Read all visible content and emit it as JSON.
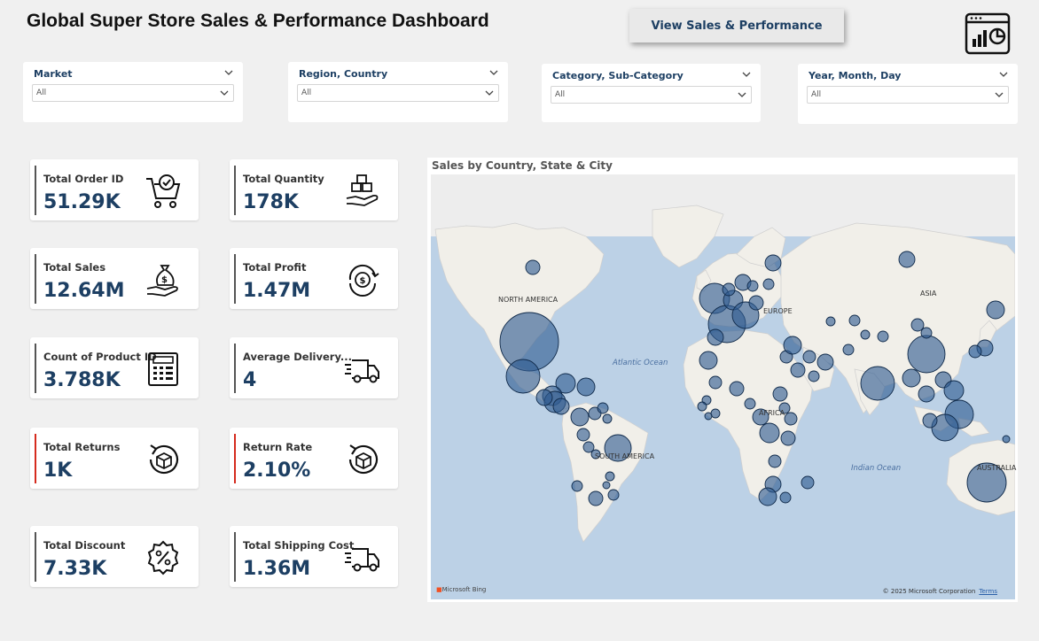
{
  "header": {
    "title": "Global Super Store Sales & Performance Dashboard",
    "view_button": "View Sales & Performance",
    "icon": "dashboard-report-icon"
  },
  "slicers": [
    {
      "label": "Market",
      "value": "All"
    },
    {
      "label": "Region, Country",
      "value": "All"
    },
    {
      "label": "Category, Sub-Category",
      "value": "All"
    },
    {
      "label": "Year, Month, Day",
      "value": "All"
    }
  ],
  "kpis": [
    {
      "label": "Total Order ID",
      "value": "51.29K",
      "icon": "shopping-cart-check-icon"
    },
    {
      "label": "Total Quantity",
      "value": "178K",
      "icon": "boxes-in-hand-icon"
    },
    {
      "label": "Total Sales",
      "value": "12.64M",
      "icon": "money-bag-hand-icon"
    },
    {
      "label": "Total Profit",
      "value": "1.47M",
      "icon": "profit-cycle-icon"
    },
    {
      "label": "Count of Product ID",
      "value": "3.788K",
      "icon": "calculator-icon"
    },
    {
      "label": "Average Delivery...",
      "value": "4",
      "icon": "delivery-truck-icon"
    },
    {
      "label": "Total Returns",
      "value": "1K",
      "icon": "return-box-icon"
    },
    {
      "label": "Return Rate",
      "value": "2.10%",
      "icon": "return-box-icon"
    },
    {
      "label": "Total Discount",
      "value": "7.33K",
      "icon": "discount-badge-icon"
    },
    {
      "label": "Total Shipping Cost",
      "value": "1.36M",
      "icon": "shipping-truck-icon"
    }
  ],
  "map": {
    "title": "Sales by Country, State & City",
    "labels": {
      "north_america": "NORTH AMERICA",
      "south_america": "SOUTH AMERICA",
      "asia": "ASIA",
      "africa": "AFRICA",
      "australia": "AUSTRALIA",
      "europe": "EUROPE"
    },
    "oceans": {
      "atlantic": "Atlantic Ocean",
      "indian": "Indian Ocean"
    },
    "attribution": "Microsoft Bing",
    "copyright": "© 2025 Microsoft Corporation",
    "terms": "Terms"
  },
  "colors": {
    "accent": "#1d3f63",
    "return_bar": "#d52b1e",
    "bubble_fill": "#2f5a8f",
    "water": "#bcd1e6",
    "land": "#f1efe9"
  }
}
